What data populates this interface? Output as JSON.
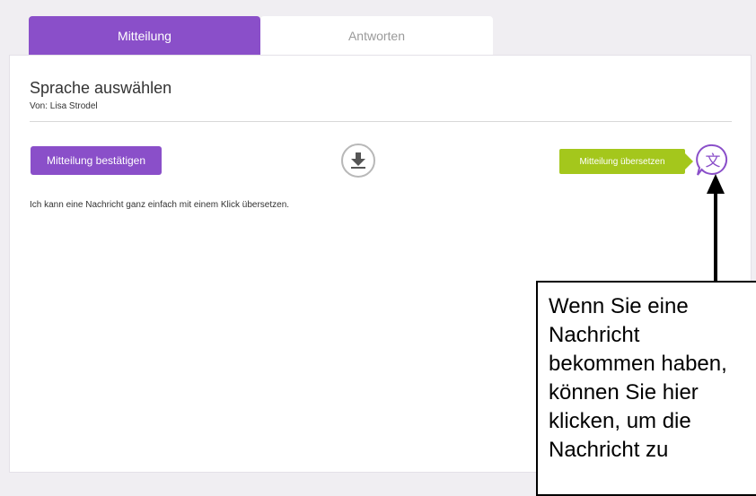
{
  "tabs": [
    {
      "label": "Mitteilung",
      "active": true
    },
    {
      "label": "Antworten",
      "active": false
    }
  ],
  "message": {
    "title": "Sprache auswählen",
    "sender": "Von: Lisa Strodel",
    "confirm_label": "Mitteilung bestätigen",
    "body": "Ich kann eine Nachricht ganz einfach mit einem Klick übersetzen.",
    "translate_tooltip": "Mitteilung übersetzen",
    "translate_glyph": "文"
  },
  "annotation": {
    "text": "Wenn Sie eine\nNachricht\nbekommen haben,\nkönnen Sie hier\nklicken, um die\nNachricht zu"
  },
  "icons": {
    "download": "download-icon",
    "translate": "translate-icon"
  },
  "colors": {
    "accent": "#8a4fc9",
    "tooltip": "#a4c71c",
    "background": "#f0eef2"
  }
}
